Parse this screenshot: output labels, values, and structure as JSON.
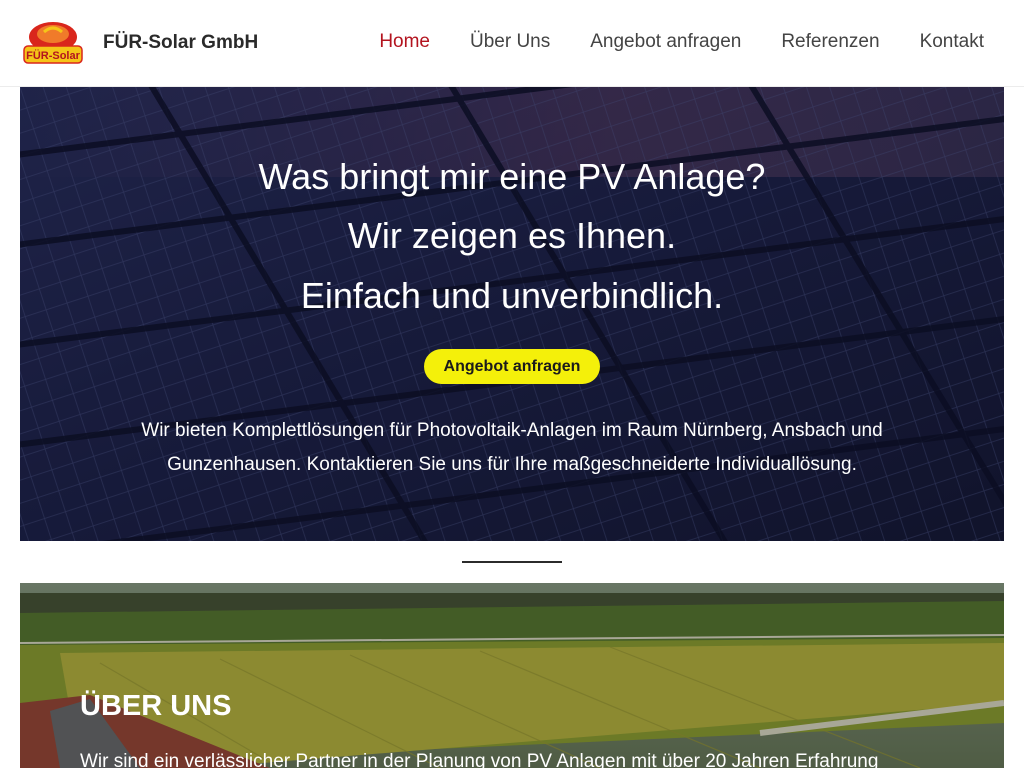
{
  "header": {
    "brand_name": "FÜR-Solar GmbH",
    "logo_text": "FÜR-Solar",
    "nav": [
      {
        "label": "Home",
        "active": true
      },
      {
        "label": "Über Uns",
        "active": false
      },
      {
        "label": "Angebot anfragen",
        "active": false
      },
      {
        "label": "Referenzen",
        "active": false
      },
      {
        "label": "Kontakt",
        "active": false
      }
    ]
  },
  "hero": {
    "headline_lines": [
      "Was bringt mir eine PV Anlage?",
      "Wir zeigen es Ihnen.",
      "Einfach und unverbindlich."
    ],
    "cta_label": "Angebot anfragen",
    "description": "Wir bieten Komplettlösungen für Photovoltaik-Anlagen im Raum Nürnberg, Ansbach und Gunzenhausen. Kontaktieren Sie uns für Ihre maßgeschneiderte Individuallösung."
  },
  "about": {
    "heading": "ÜBER UNS",
    "text": "Wir sind ein verlässlicher Partner in der Planung von PV Anlagen mit über 20 Jahren Erfahrung"
  },
  "colors": {
    "nav_active": "#b3141f",
    "nav_text": "#444444",
    "cta_background": "#f4f00a",
    "hero_panel_dark": "#1a1d3d",
    "logo_red": "#d9261c",
    "logo_yellow": "#f5c518"
  },
  "icons": {
    "logo": "sun-logo-icon"
  }
}
